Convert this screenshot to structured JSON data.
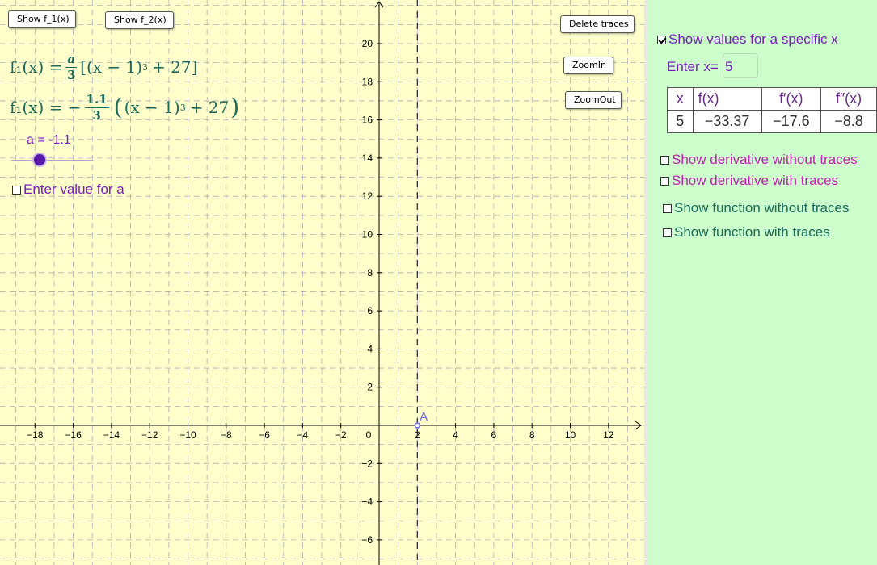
{
  "buttons": {
    "show_f1": "Show f_1(x)",
    "show_f2": "Show f_2(x)",
    "delete_traces": "Delete traces",
    "zoom_in": "ZoomIn",
    "zoom_out": "ZoomOut"
  },
  "formula1": {
    "lhs": "f₁(x) =",
    "frac_num": "a",
    "frac_den": "3",
    "body": "[(x − 1)",
    "exp": "3",
    "tail": "+ 27]"
  },
  "formula2": {
    "lhs": "f₁(x) = −",
    "frac_num": "1.1",
    "frac_den": "3",
    "body": "(x − 1)",
    "exp": "3",
    "tail": "+ 27"
  },
  "slider": {
    "label": "a = -1.1",
    "fraction": 0.35
  },
  "enter_a_checkbox": {
    "label": "Enter value for a",
    "checked": false
  },
  "graph": {
    "x_ticks": [
      "−18",
      "−16",
      "−14",
      "−12",
      "−10",
      "−8",
      "−6",
      "−4",
      "−2",
      "0",
      "2",
      "4",
      "6",
      "8",
      "10",
      "12"
    ],
    "y_ticks_pos": [
      "2",
      "4",
      "6",
      "8",
      "10",
      "12",
      "14",
      "16",
      "18",
      "20"
    ],
    "y_ticks_neg": [
      "−2",
      "−4",
      "−6"
    ],
    "point_label": "A",
    "colors": {
      "axis": "#000000",
      "grid": "#b0b0b0",
      "point": "#6666ff",
      "dashed_line": "#222222"
    }
  },
  "side": {
    "show_values": {
      "label": "Show values for a specific x",
      "checked": true
    },
    "enter_x": {
      "label": "Enter x=",
      "value": "5"
    },
    "table": {
      "headers": [
        "x",
        "f(x)",
        "f′(x)",
        "f″(x)"
      ],
      "values": [
        "5",
        "−33.37",
        "−17.6",
        "−8.8"
      ]
    },
    "checkboxes": [
      {
        "label": "Show derivative without traces",
        "checked": false
      },
      {
        "label": "Show derivative with traces",
        "checked": false
      },
      {
        "label": "Show function without traces",
        "checked": false
      },
      {
        "label": "Show function with traces",
        "checked": false
      }
    ]
  },
  "colors": {
    "graph_bg": "#ffffcc",
    "side_bg": "#ccffcc",
    "formula": "#1a6b5c",
    "purple": "#7a1bc2",
    "magenta": "#c020b0"
  }
}
